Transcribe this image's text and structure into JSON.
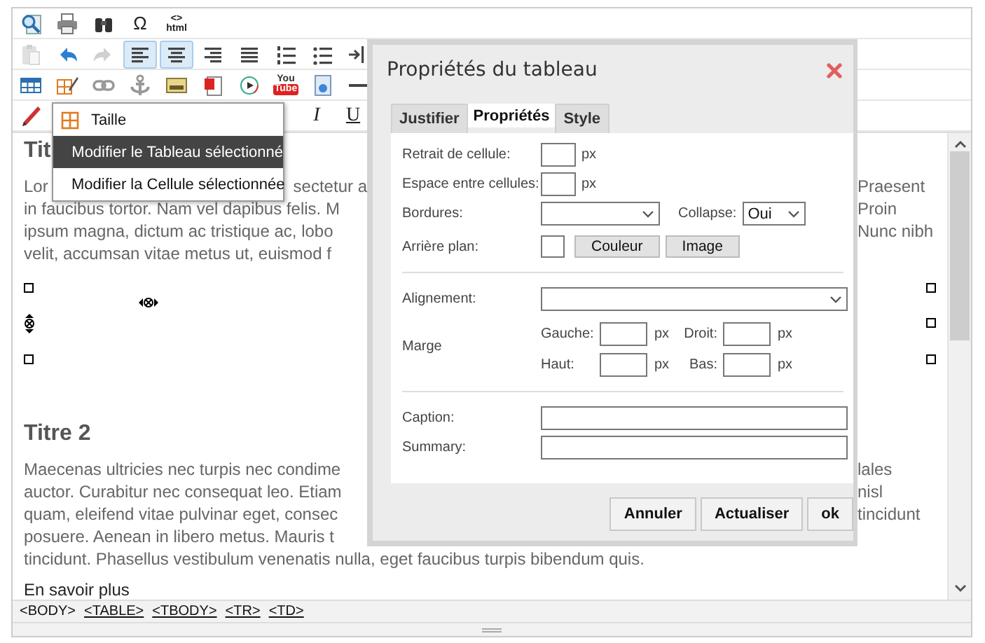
{
  "toolbar": {
    "rows": [
      [
        {
          "kind": "preview",
          "selected": false,
          "disabled": false
        },
        {
          "kind": "print",
          "selected": false,
          "disabled": false
        },
        {
          "kind": "find",
          "selected": false,
          "disabled": false
        },
        {
          "kind": "special-char",
          "label": "Ω",
          "selected": false,
          "disabled": false
        },
        {
          "kind": "html",
          "label": "<>",
          "caption": "html",
          "selected": false,
          "disabled": false
        }
      ],
      [
        {
          "kind": "paste",
          "selected": false,
          "disabled": true
        },
        {
          "kind": "undo",
          "selected": false,
          "disabled": false
        },
        {
          "kind": "redo",
          "selected": false,
          "disabled": true
        },
        {
          "kind": "align-left",
          "selected": true,
          "disabled": false
        },
        {
          "kind": "align-center",
          "selected": true,
          "disabled": false
        },
        {
          "kind": "align-right",
          "selected": false,
          "disabled": false
        },
        {
          "kind": "justify",
          "selected": false,
          "disabled": false
        },
        {
          "kind": "ordered-list",
          "selected": false,
          "disabled": false
        },
        {
          "kind": "bullet-list",
          "selected": false,
          "disabled": false
        },
        {
          "kind": "indent",
          "selected": false,
          "disabled": false
        }
      ],
      [
        {
          "kind": "table",
          "selected": false,
          "disabled": false
        },
        {
          "kind": "table-edit",
          "selected": false,
          "disabled": false
        },
        {
          "kind": "link",
          "selected": false,
          "disabled": false
        },
        {
          "kind": "anchor",
          "selected": false,
          "disabled": false
        },
        {
          "kind": "image",
          "selected": false,
          "disabled": false
        },
        {
          "kind": "flash",
          "selected": false,
          "disabled": false
        },
        {
          "kind": "media",
          "selected": false,
          "disabled": false
        },
        {
          "kind": "youtube",
          "label": "You",
          "caption": "Tube",
          "selected": false,
          "disabled": false
        },
        {
          "kind": "document",
          "selected": false,
          "disabled": false
        },
        {
          "kind": "rule",
          "selected": false,
          "disabled": false
        }
      ],
      [
        {
          "kind": "pencil",
          "selected": false,
          "disabled": false
        },
        {
          "kind": "italic",
          "label": "I",
          "selected": false,
          "disabled": false
        },
        {
          "kind": "underline",
          "label": "U",
          "selected": false,
          "disabled": false
        }
      ]
    ]
  },
  "context_menu": {
    "items": [
      {
        "label": "Taille",
        "selected": false
      },
      {
        "label": "Modifier le Tableau sélectionné",
        "selected": true
      },
      {
        "label": "Modifier la Cellule sélectionnée",
        "selected": false
      }
    ]
  },
  "content": {
    "heading_1": "Tit",
    "paragraph_1": [
      {
        "left": "Lor",
        "middle": "sectetur a",
        "right": "Praesent"
      },
      {
        "left": "in faucibus tortor. Nam vel dapibus felis. M",
        "right": "Proin"
      },
      {
        "left": "ipsum magna, dictum ac tristique ac, lobo",
        "right": "Nunc nibh"
      },
      {
        "left": "velit, accumsan vitae metus ut, euismod f"
      }
    ],
    "heading_2": "Titre 2",
    "paragraph_2": [
      {
        "left": "Maecenas ultricies nec turpis nec condime",
        "right": "lales"
      },
      {
        "left": "auctor. Curabitur nec consequat leo. Etiam",
        "right": "nisl"
      },
      {
        "left": "quam, eleifend vitae pulvinar eget, consec",
        "right": "tincidunt"
      },
      {
        "left": "posuere. Aenean in libero metus. Mauris t"
      },
      {
        "full": "tincidunt. Phasellus vestibulum venenatis nulla, eget faucibus turpis bibendum quis."
      }
    ],
    "closing_text": "En savoir plus"
  },
  "status_path": [
    {
      "label": "<BODY>",
      "link": false
    },
    {
      "label": "<TABLE>",
      "link": true
    },
    {
      "label": "<TBODY>",
      "link": true
    },
    {
      "label": "<TR>",
      "link": true
    },
    {
      "label": "<TD>",
      "link": true
    }
  ],
  "dialog": {
    "title": "Propriétés du tableau",
    "tabs": [
      {
        "label": "Justifier",
        "selected": false
      },
      {
        "label": "Propriétés",
        "selected": true
      },
      {
        "label": "Style",
        "selected": false
      }
    ],
    "cell_padding": {
      "label": "Retrait de cellule:",
      "unit": "px"
    },
    "cell_spacing": {
      "label": "Espace entre cellules:",
      "unit": "px"
    },
    "borders": {
      "label": "Bordures:"
    },
    "collapse": {
      "label": "Collapse:",
      "value": "Oui"
    },
    "background": {
      "label": "Arrière plan:",
      "buttons": [
        "Couleur",
        "Image"
      ]
    },
    "alignment": {
      "label": "Alignement:"
    },
    "margin": {
      "label": "Marge",
      "fields": [
        {
          "label": "Gauche:",
          "unit": "px"
        },
        {
          "label": "Droit:",
          "unit": "px"
        },
        {
          "label": "Haut:",
          "unit": "px"
        },
        {
          "label": "Bas:",
          "unit": "px"
        }
      ]
    },
    "caption": {
      "label": "Caption:"
    },
    "summary": {
      "label": "Summary:"
    },
    "buttons": [
      "Annuler",
      "Actualiser",
      "ok"
    ]
  }
}
